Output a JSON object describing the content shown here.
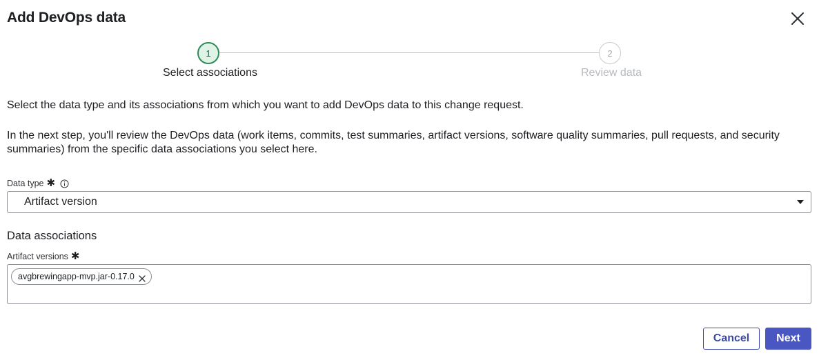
{
  "dialog": {
    "title": "Add DevOps data",
    "close_icon": "close-icon"
  },
  "stepper": {
    "steps": [
      {
        "number": "1",
        "label": "Select associations",
        "state": "active"
      },
      {
        "number": "2",
        "label": "Review data",
        "state": "inactive"
      }
    ]
  },
  "intro": {
    "line1": "Select the data type and its associations from which you want to add DevOps data to this change request.",
    "line2": "In the next step, you'll review the DevOps data (work items, commits, test summaries, artifact versions, software quality summaries, pull requests, and security summaries) from the specific data associations you select here."
  },
  "data_type": {
    "label": "Data type",
    "required_mark": "✱",
    "info_icon": "info-icon",
    "value": "Artifact version"
  },
  "associations": {
    "heading": "Data associations",
    "field_label": "Artifact versions",
    "required_mark": "✱",
    "chips": [
      {
        "label": "avgbrewingapp-mvp.jar-0.17.0"
      }
    ]
  },
  "footer": {
    "cancel_label": "Cancel",
    "next_label": "Next"
  },
  "colors": {
    "primary": "#4a57c2",
    "step_active_fill": "#dff3e6",
    "step_active_border": "#2e8b57"
  }
}
